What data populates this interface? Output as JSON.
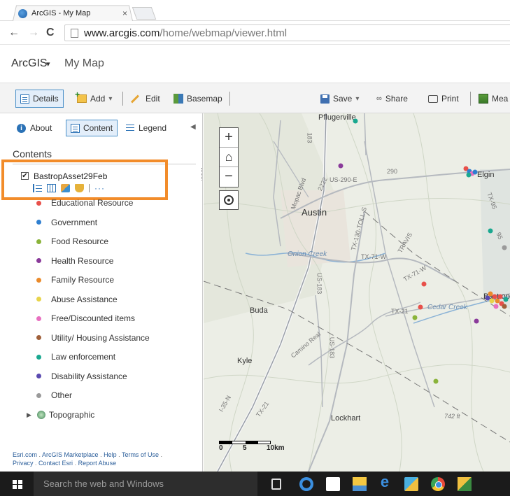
{
  "browser": {
    "tab_title": "ArcGIS - My Map",
    "tab_close": "×",
    "url_host": "www.arcgis.com",
    "url_path": "/home/webmap/viewer.html",
    "back": "←",
    "forward": "→",
    "reload": "C"
  },
  "app": {
    "brand": "ArcGIS",
    "brand_caret": "▾",
    "map_name": "My Map"
  },
  "toolbar": {
    "details": "Details",
    "add": "Add",
    "add_caret": "▾",
    "edit": "Edit",
    "basemap": "Basemap",
    "save": "Save",
    "save_caret": "▾",
    "share": "Share",
    "share_icon": "∞",
    "print": "Print",
    "measure": "Mea"
  },
  "panel": {
    "tabs": {
      "about": "About",
      "about_icon": "i",
      "content": "Content",
      "legend": "Legend"
    },
    "collapse": "◀",
    "contents_title": "Contents",
    "layer": {
      "checkbox": "✔",
      "name": "BastropAsset29Feb",
      "more": "···",
      "legend_items": [
        {
          "label": "Educational Resource",
          "color": "#e8504a"
        },
        {
          "label": "Government",
          "color": "#2f7fd0"
        },
        {
          "label": "Food Resource",
          "color": "#8ab33a"
        },
        {
          "label": "Health Resource",
          "color": "#8a3a9a"
        },
        {
          "label": "Family Resource",
          "color": "#ea8a2a"
        },
        {
          "label": "Abuse Assistance",
          "color": "#e8d44a"
        },
        {
          "label": "Free/Discounted items",
          "color": "#e870c0"
        },
        {
          "label": "Utility/ Housing Assistance",
          "color": "#a0603a"
        },
        {
          "label": "Law enforcement",
          "color": "#1aa890"
        },
        {
          "label": "Disability Assistance",
          "color": "#5a4ab0"
        },
        {
          "label": "Other",
          "color": "#9a9a9a"
        }
      ]
    },
    "basemap_layer": {
      "arrow": "▶",
      "name": "Topographic"
    },
    "footer": {
      "esri": "Esri.com",
      "marketplace": "ArcGIS Marketplace",
      "help": "Help",
      "terms": "Terms of Use",
      "privacy": "Privacy",
      "contact": "Contact Esri",
      "report": "Report Abuse",
      "sep": " . "
    }
  },
  "map": {
    "zoom_in": "+",
    "home": "⌂",
    "zoom_out": "−",
    "places": {
      "pflugerville": "Pflugerville",
      "austin": "Austin",
      "elgin": "Elgin",
      "buda": "Buda",
      "kyle": "Kyle",
      "lockhart": "Lockhart",
      "bastrop": "Bastrop"
    },
    "roads": {
      "us290e": "US-290-E",
      "r290": "290",
      "r2222": "2222",
      "mopac": "Mopac Blvd",
      "tx71w": "TX-71-W",
      "tx21": "TX-21",
      "us183": "US-183",
      "r183": "183",
      "tx130": "TX-130-TOLL-S",
      "camino": "Camino Real",
      "i35n": "I-35-N",
      "tx95": "TX-95",
      "r95": "95",
      "onion": "Onion Creek",
      "cedar": "Cedar Creek",
      "elev": "742 ft",
      "travis": "TRAVIS"
    },
    "scale": {
      "zero": "0",
      "five": "5",
      "ten": "10km"
    }
  },
  "taskbar": {
    "search_placeholder": "Search the web and Windows"
  }
}
